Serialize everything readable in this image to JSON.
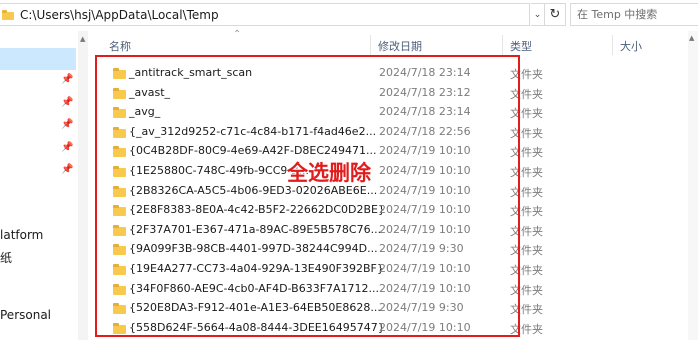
{
  "address_bar": {
    "path": "C:\\Users\\hsj\\AppData\\Local\\Temp",
    "search_placeholder": "在 Temp 中搜索"
  },
  "nav_pane": {
    "items": [
      {
        "label": "latform"
      },
      {
        "label": "纸"
      },
      {
        "label": "Personal"
      }
    ]
  },
  "columns": {
    "name": "名称",
    "date": "修改日期",
    "type": "类型",
    "size": "大小"
  },
  "files": [
    {
      "name": "_antitrack_smart_scan",
      "date": "2024/7/18 23:14",
      "type": "文件夹"
    },
    {
      "name": "_avast_",
      "date": "2024/7/18 23:12",
      "type": "文件夹"
    },
    {
      "name": "_avg_",
      "date": "2024/7/18 23:14",
      "type": "文件夹"
    },
    {
      "name": "{_av_312d9252-c71c-4c84-b171-f4ad46e2...",
      "date": "2024/7/18 22:56",
      "type": "文件夹"
    },
    {
      "name": "{0C4B28DF-80C9-4e69-A42F-D8EC249471...",
      "date": "2024/7/19 10:10",
      "type": "文件夹"
    },
    {
      "name": "{1E25880C-748C-49fb-9CC9-B...",
      "date": "2024/7/19 10:10",
      "type": "文件夹"
    },
    {
      "name": "{2B8326CA-A5C5-4b06-9ED3-02026ABE6E...",
      "date": "2024/7/19 10:10",
      "type": "文件夹"
    },
    {
      "name": "{2E8F8383-8E0A-4c42-B5F2-22662DC0D2BE}",
      "date": "2024/7/19 10:10",
      "type": "文件夹"
    },
    {
      "name": "{2F37A701-E367-471a-89AC-89E5B578C76...",
      "date": "2024/7/19 10:10",
      "type": "文件夹"
    },
    {
      "name": "{9A099F3B-98CB-4401-997D-38244C994D...",
      "date": "2024/7/19 9:30",
      "type": "文件夹"
    },
    {
      "name": "{19E4A277-CC73-4a04-929A-13E490F392BF}",
      "date": "2024/7/19 10:10",
      "type": "文件夹"
    },
    {
      "name": "{34F0F860-AE9C-4cb0-AF4D-B633F7A1712...",
      "date": "2024/7/19 10:10",
      "type": "文件夹"
    },
    {
      "name": "{520E8DA3-F912-401e-A1E3-64EB50E8628...",
      "date": "2024/7/19 9:30",
      "type": "文件夹"
    },
    {
      "name": "{558D624F-5664-4a08-8444-3DEE16495747}",
      "date": "2024/7/19 10:10",
      "type": "文件夹"
    }
  ],
  "annotation": {
    "text": "全选删除",
    "color": "#e11c1c"
  },
  "icons": {
    "folder": "folder-icon",
    "pin": "pin-icon",
    "refresh": "refresh-icon",
    "chevron": "chevron-down-icon",
    "sort": "sort-ascending-icon"
  }
}
